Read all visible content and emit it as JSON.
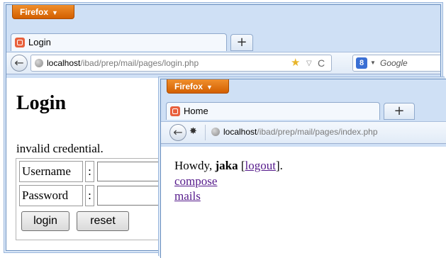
{
  "back_window": {
    "firefox_button": "Firefox",
    "tab": {
      "title": "Login"
    },
    "new_tab": "+",
    "url": {
      "host": "localhost",
      "path": "/ibad/prep/mail/pages/login.php"
    },
    "search": {
      "placeholder": "Google"
    },
    "page": {
      "heading": "Login",
      "message": "invalid credential.",
      "fields": [
        {
          "label": "Username",
          "colon": ":",
          "value": ""
        },
        {
          "label": "Password",
          "colon": ":",
          "value": ""
        }
      ],
      "buttons": {
        "login": "login",
        "reset": "reset"
      }
    }
  },
  "front_window": {
    "firefox_button": "Firefox",
    "tab": {
      "title": "Home"
    },
    "new_tab": "+",
    "url": {
      "host": "localhost",
      "path": "/ibad/prep/mail/pages/index.php"
    },
    "page": {
      "greeting_prefix": "Howdy, ",
      "username": "jaka",
      "logout_open": " [",
      "logout_label": "logout",
      "logout_close": "].",
      "links": {
        "compose": "compose",
        "mails": "mails"
      }
    }
  },
  "colors": {
    "firefox_orange": "#e67316",
    "visited_link": "#551a8b",
    "chrome_blue": "#cfe0f5"
  }
}
